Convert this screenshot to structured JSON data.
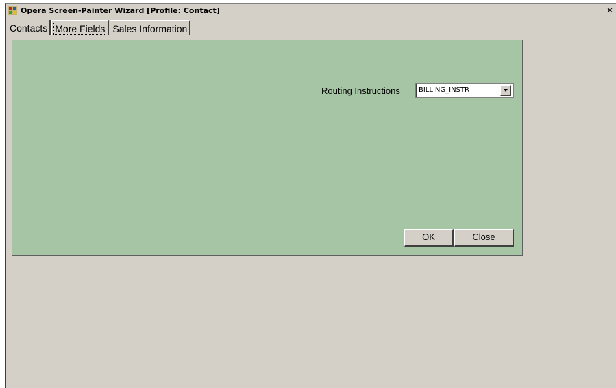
{
  "window": {
    "title": "Opera Screen-Painter Wizard [Profile: Contact]",
    "close_label": "✕",
    "app_icon": "opera-app-icon"
  },
  "tabs": [
    {
      "label": "Contacts",
      "active": false
    },
    {
      "label": "More Fields",
      "active": true
    },
    {
      "label": "Sales Information",
      "active": false
    }
  ],
  "form": {
    "routing_label": "Routing Instructions",
    "routing_value": "BILLING_INSTR",
    "dropdown_icon": "dropdown-arrow-icon"
  },
  "buttons": {
    "ok_mnemonic": "O",
    "ok_rest": "K",
    "close_mnemonic": "C",
    "close_rest": "lose"
  },
  "colors": {
    "panel": "#a6c5a5",
    "window": "#d4d0c8"
  }
}
